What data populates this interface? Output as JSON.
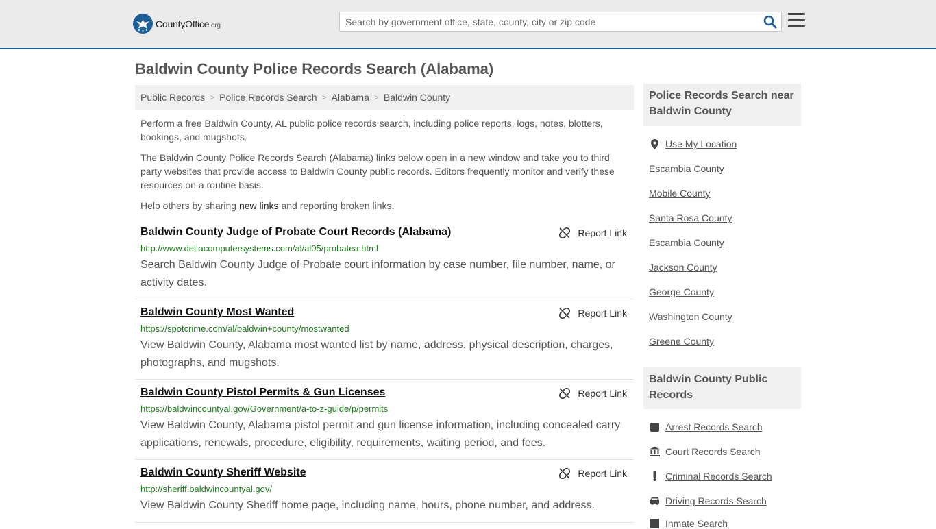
{
  "header": {
    "logo_main": "CountyOffice",
    "logo_tld": ".org",
    "search_placeholder": "Search by government office, state, county, city or zip code"
  },
  "page_title": "Baldwin County Police Records Search (Alabama)",
  "breadcrumb": [
    "Public Records",
    "Police Records Search",
    "Alabama",
    "Baldwin County"
  ],
  "intro": {
    "p1": "Perform a free Baldwin County, AL public police records search, including police reports, logs, notes, blotters, bookings, and mugshots.",
    "p2": "The Baldwin County Police Records Search (Alabama) links below open in a new window and take you to third party websites that provide access to Baldwin County public records. Editors frequently monitor and verify these resources on a routine basis.",
    "p3_before": "Help others by sharing ",
    "p3_link": "new links",
    "p3_after": " and reporting broken links."
  },
  "report_label": "Report Link",
  "results": [
    {
      "title": "Baldwin County Judge of Probate Court Records (Alabama)",
      "url": "http://www.deltacomputersystems.com/al/al05/probatea.html",
      "desc": "Search Baldwin County Judge of Probate court information by case number, file number, name, or activity dates."
    },
    {
      "title": "Baldwin County Most Wanted",
      "url": "https://spotcrime.com/al/baldwin+county/mostwanted",
      "desc": "View Baldwin County, Alabama most wanted list by name, address, physical description, charges, photographs, and mugshots."
    },
    {
      "title": "Baldwin County Pistol Permits & Gun Licenses",
      "url": "https://baldwincountyal.gov/Government/a-to-z-guide/p/permits",
      "desc": "View Baldwin County, Alabama pistol permit and gun license information, including concealed carry applications, renewals, procedure, eligibility, requirements, waiting period, and fees."
    },
    {
      "title": "Baldwin County Sheriff Website",
      "url": "http://sheriff.baldwincountyal.gov/",
      "desc": "View Baldwin County Sheriff home page, including name, hours, phone number, and address."
    }
  ],
  "sidebar": {
    "nearby_heading": "Police Records Search near Baldwin County",
    "use_location": "Use My Location",
    "nearby": [
      "Escambia County",
      "Mobile County",
      "Santa Rosa County",
      "Escambia County",
      "Jackson County",
      "George County",
      "Washington County",
      "Greene County"
    ],
    "public_heading": "Baldwin County Public Records",
    "public_links": [
      {
        "label": "Arrest Records Search",
        "icon": "arrest-icon"
      },
      {
        "label": "Court Records Search",
        "icon": "courthouse-icon"
      },
      {
        "label": "Criminal Records Search",
        "icon": "exclamation-icon"
      },
      {
        "label": "Driving Records Search",
        "icon": "car-icon"
      },
      {
        "label": "Inmate Search",
        "icon": "inmate-icon"
      }
    ]
  },
  "colors": {
    "brand": "#1f5f98",
    "url_green": "#1e7a1e"
  }
}
